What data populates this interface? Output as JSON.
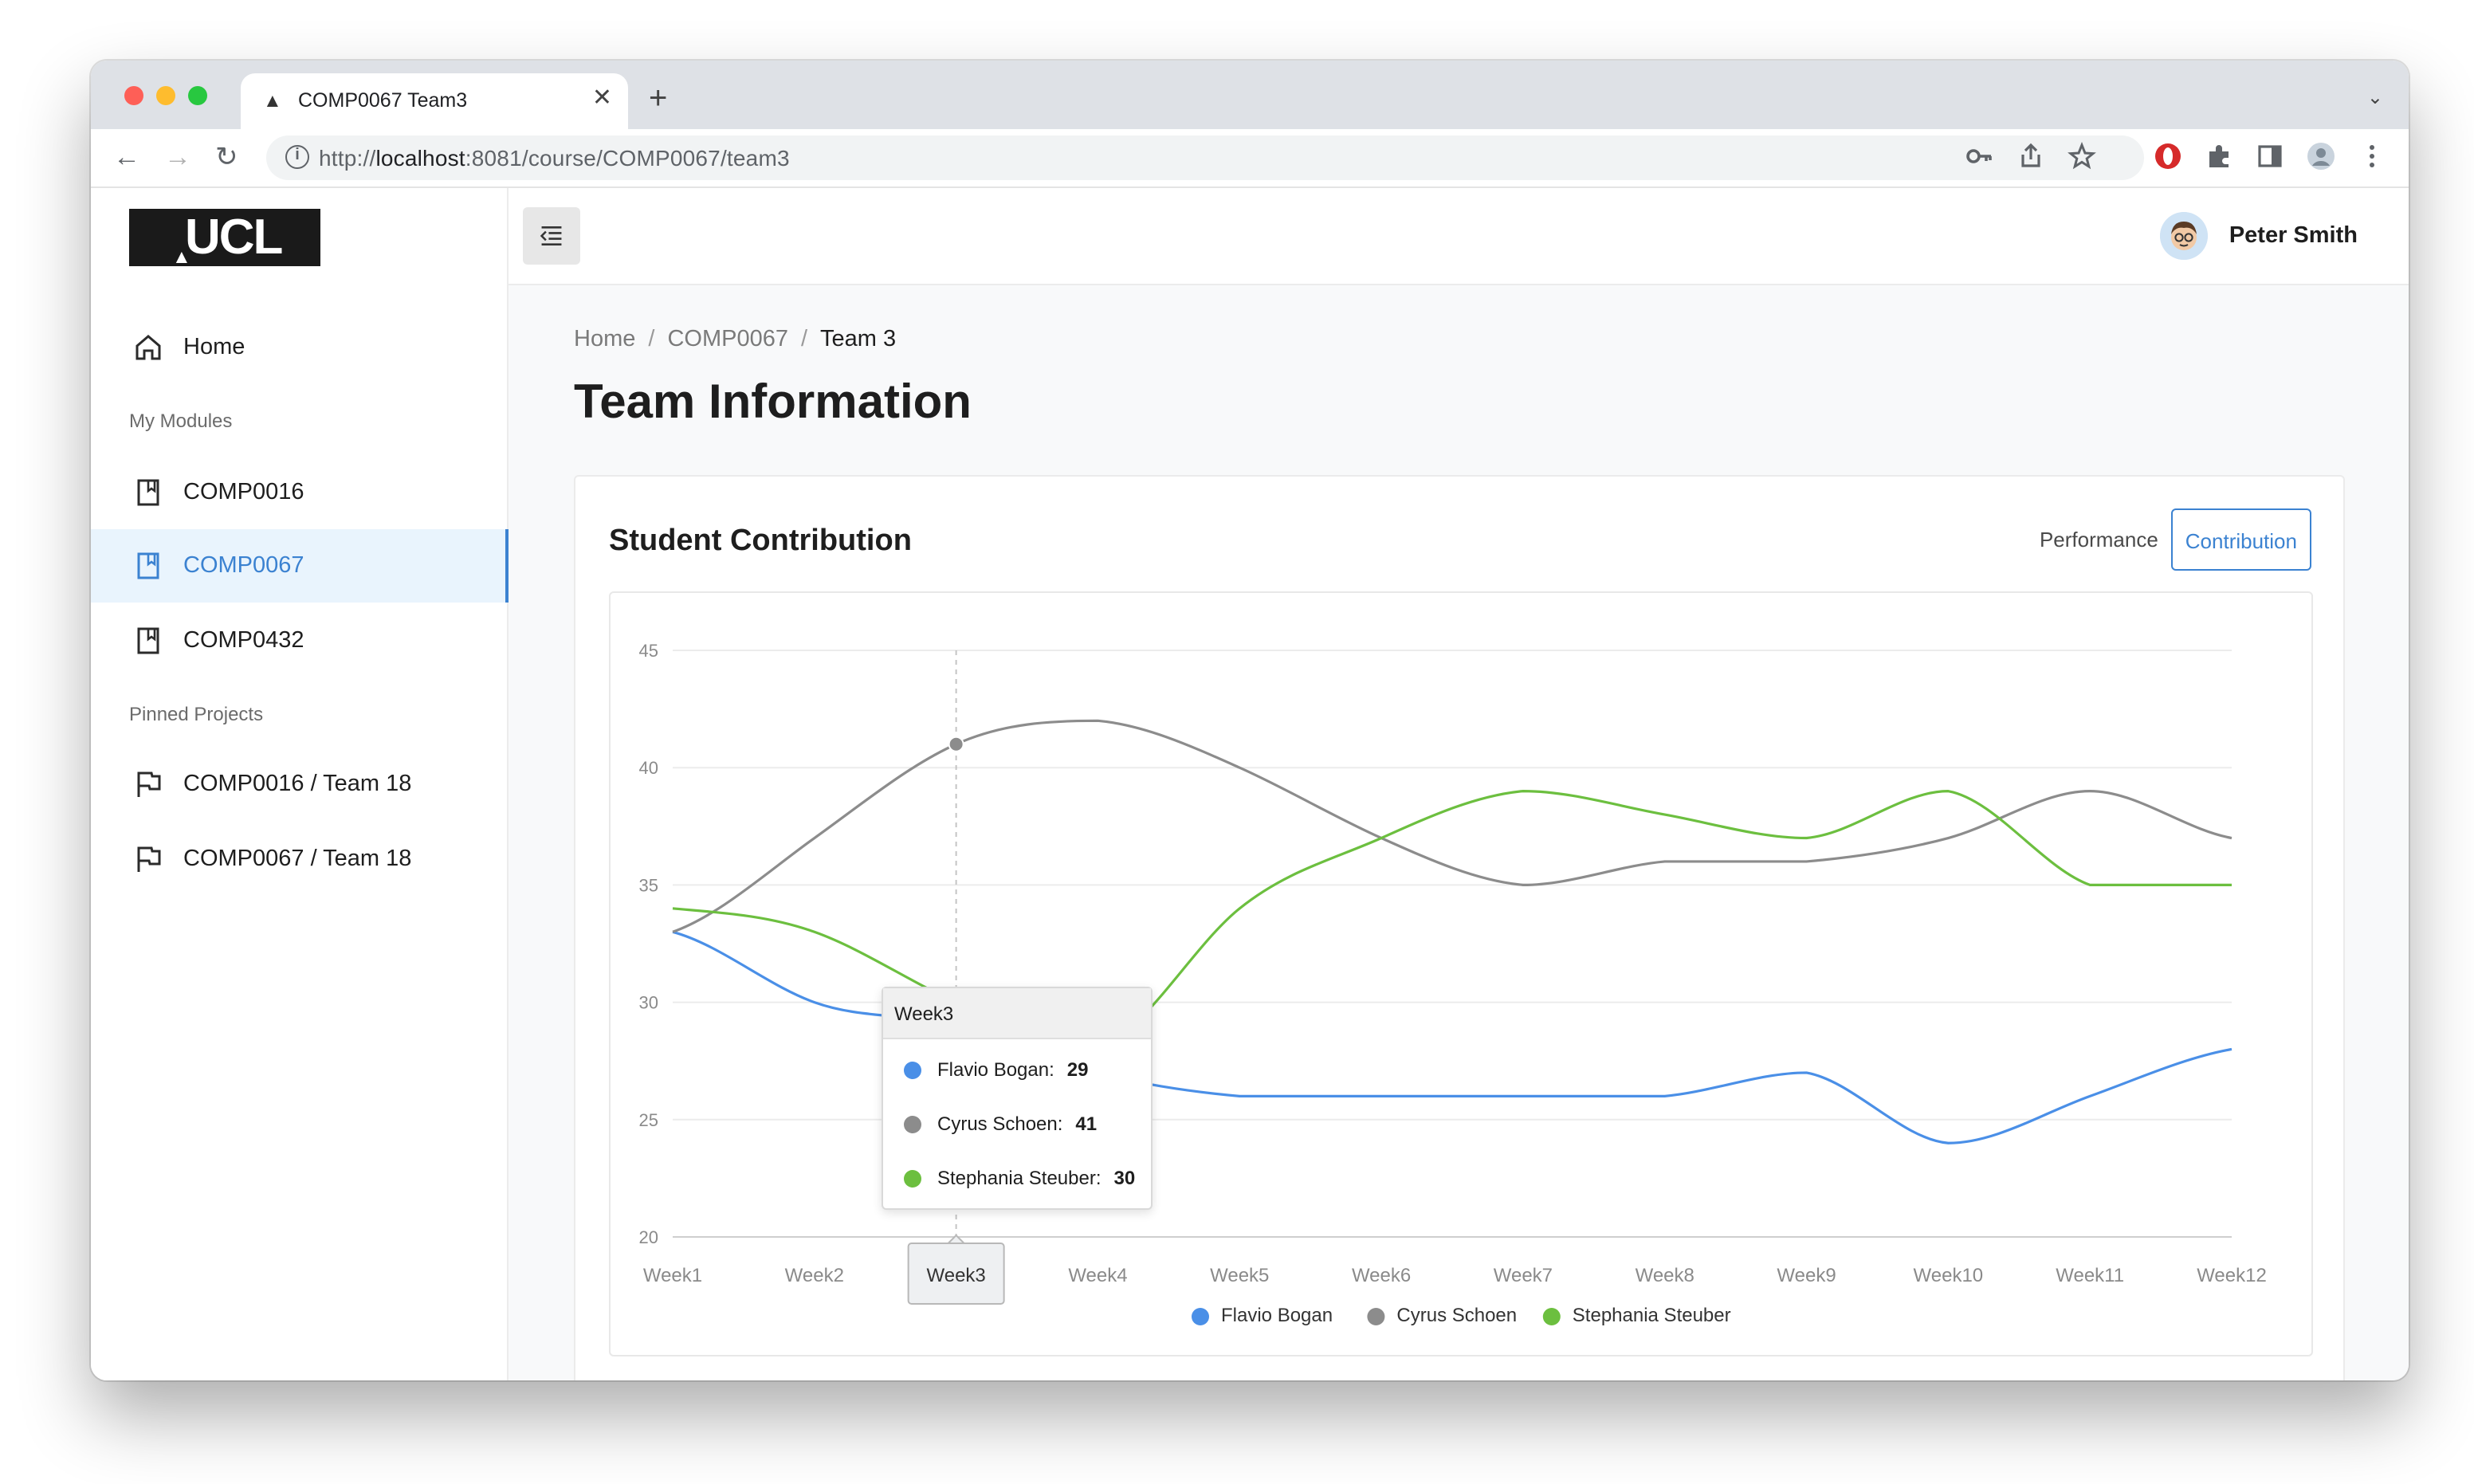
{
  "browser": {
    "tab_title": "COMP0067 Team3",
    "url_prefix": "http://",
    "url_host": "localhost",
    "url_rest": ":8081/course/COMP0067/team3"
  },
  "sidebar": {
    "logo_text": "UCL",
    "home": "Home",
    "modules_label": "My Modules",
    "modules": [
      "COMP0016",
      "COMP0067",
      "COMP0432"
    ],
    "pinned_label": "Pinned Projects",
    "pinned": [
      "COMP0016 / Team 18",
      "COMP0067 / Team 18"
    ]
  },
  "header": {
    "user_name": "Peter Smith"
  },
  "breadcrumb": {
    "home": "Home",
    "module": "COMP0067",
    "current": "Team 3"
  },
  "page_title": "Team Information",
  "card": {
    "title": "Student Contribution",
    "tab_performance": "Performance",
    "tab_contribution": "Contribution"
  },
  "chart_data": {
    "type": "line",
    "x": [
      "Week1",
      "Week2",
      "Week3",
      "Week4",
      "Week5",
      "Week6",
      "Week7",
      "Week8",
      "Week9",
      "Week10",
      "Week11",
      "Week12"
    ],
    "ylim": [
      20,
      45
    ],
    "yticks": [
      20,
      25,
      30,
      35,
      40,
      45
    ],
    "series": [
      {
        "name": "Flavio Bogan",
        "color": "#4a8fe7",
        "values": [
          33,
          30,
          29,
          27,
          26,
          26,
          26,
          26,
          27,
          24,
          26,
          28
        ]
      },
      {
        "name": "Cyrus Schoen",
        "color": "#8c8c8c",
        "values": [
          33,
          37,
          41,
          42,
          40,
          37,
          35,
          36,
          36,
          37,
          39,
          37
        ]
      },
      {
        "name": "Stephania Steuber",
        "color": "#6cbf3f",
        "values": [
          34,
          33,
          30,
          28,
          34,
          37,
          39,
          38,
          37,
          39,
          35,
          35
        ]
      }
    ],
    "legend_position": "bottom",
    "grid": true,
    "highlight_index": 2,
    "tooltip": {
      "title": "Week3",
      "rows": [
        {
          "name": "Flavio Bogan:",
          "value": "29"
        },
        {
          "name": "Cyrus Schoen:",
          "value": "41"
        },
        {
          "name": "Stephania Steuber:",
          "value": "30"
        }
      ]
    }
  }
}
